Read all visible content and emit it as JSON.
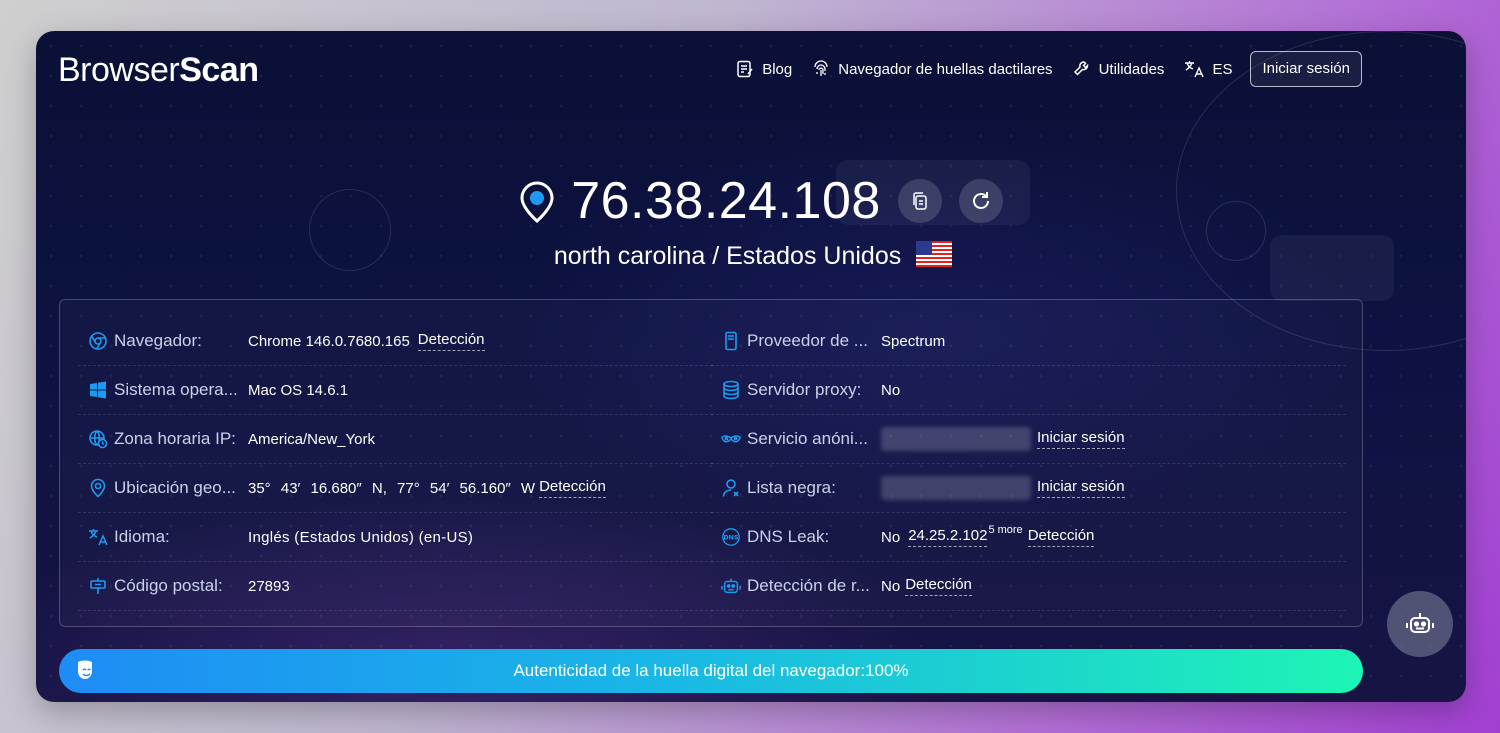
{
  "header": {
    "logo_prefix": "Browser",
    "logo_suffix": "Scan",
    "nav": {
      "blog": "Blog",
      "fingerprint_browser": "Navegador de huellas dactilares",
      "utilities": "Utilidades",
      "language": "ES"
    },
    "login": "Iniciar sesión"
  },
  "ip": {
    "address": "76.38.24.108",
    "location": "north carolina / Estados Unidos",
    "copy_icon": "copy-icon",
    "refresh_icon": "refresh-icon",
    "pin_icon": "location-pin-icon"
  },
  "info": {
    "left": [
      {
        "label": "Navegador:",
        "value": "Chrome 146.0.7680.165",
        "link": "Detección",
        "icon": "chrome-icon"
      },
      {
        "label": "Sistema opera...",
        "value": "Mac OS 14.6.1",
        "icon": "windows-icon"
      },
      {
        "label": "Zona horaria IP:",
        "value": "America/New_York",
        "icon": "globe-clock-icon"
      },
      {
        "label": "Ubicación geo...",
        "value": "35° 43′ 16.680″ N, 77° 54′ 56.160″ W",
        "link": "Detección",
        "icon": "location-icon"
      },
      {
        "label": "Idioma:",
        "value": "Inglés (Estados Unidos) (en-US)",
        "icon": "translate-icon"
      },
      {
        "label": "Código postal:",
        "value": "27893",
        "icon": "postal-sign-icon"
      }
    ],
    "right": [
      {
        "label": "Proveedor de ...",
        "value": "Spectrum",
        "icon": "server-icon"
      },
      {
        "label": "Servidor proxy:",
        "value": "No",
        "icon": "database-icon"
      },
      {
        "label": "Servicio anóni...",
        "link": "Iniciar sesión",
        "icon": "mask-icon"
      },
      {
        "label": "Lista negra:",
        "link": "Iniciar sesión",
        "icon": "user-icon"
      },
      {
        "label": "DNS Leak:",
        "value": "No",
        "dns_ip": "24.25.2.102",
        "dns_more": "5 more",
        "link": "Detección",
        "icon": "dns-icon"
      },
      {
        "label": "Detección de r...",
        "value": "No",
        "link": "Detección",
        "icon": "robot-icon"
      }
    ]
  },
  "authenticity": {
    "text": "Autenticidad de la huella digital del navegador:100%",
    "percent": 100,
    "icon": "theater-masks-icon"
  },
  "colors": {
    "accent": "#1e9bf0",
    "bar_start": "#1e8cf5",
    "bar_end": "#1ef5b5",
    "background": "#0b1036"
  }
}
